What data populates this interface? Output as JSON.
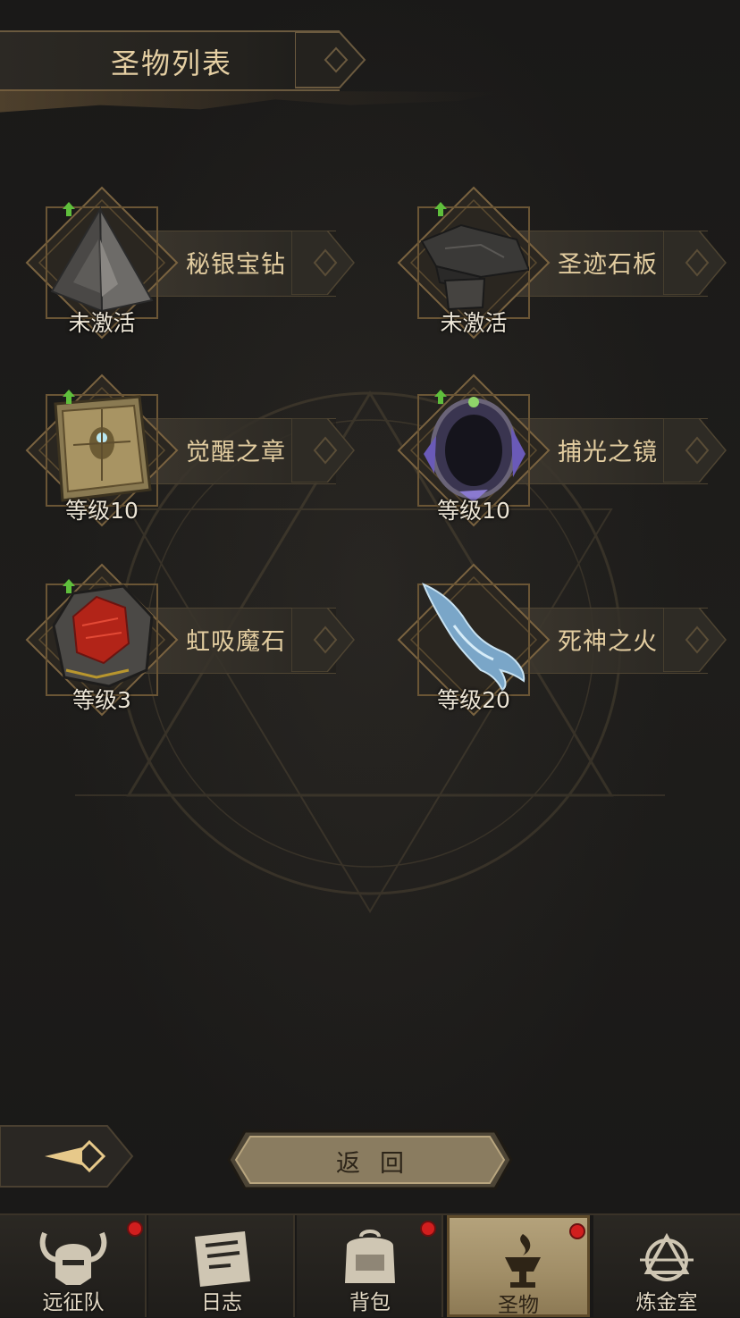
{
  "header": {
    "title": "圣物列表"
  },
  "relics": [
    {
      "name": "秘银宝钻",
      "status": "未激活",
      "icon": "pyramid-icon",
      "upgradable": true
    },
    {
      "name": "圣迹石板",
      "status": "未激活",
      "icon": "stone-slab-icon",
      "upgradable": true
    },
    {
      "name": "觉醒之章",
      "status": "等级10",
      "icon": "tome-icon",
      "upgradable": true
    },
    {
      "name": "捕光之镜",
      "status": "等级10",
      "icon": "mirror-icon",
      "upgradable": true
    },
    {
      "name": "虹吸魔石",
      "status": "等级3",
      "icon": "red-gem-stone-icon",
      "upgradable": true
    },
    {
      "name": "死神之火",
      "status": "等级20",
      "icon": "spectral-hand-icon",
      "upgradable": false
    }
  ],
  "actions": {
    "return_label": "返回"
  },
  "nav": [
    {
      "label": "远征队",
      "icon": "horned-helmet-icon",
      "badge": true,
      "active": false
    },
    {
      "label": "日志",
      "icon": "scroll-icon",
      "badge": false,
      "active": false
    },
    {
      "label": "背包",
      "icon": "backpack-icon",
      "badge": true,
      "active": false
    },
    {
      "label": "圣物",
      "icon": "brazier-icon",
      "badge": true,
      "active": true
    },
    {
      "label": "炼金室",
      "icon": "alchemy-icon",
      "badge": false,
      "active": false
    }
  ],
  "colors": {
    "accent": "#e3cda0",
    "badge": "#d11e1e",
    "active_tab": "#a08d66"
  }
}
